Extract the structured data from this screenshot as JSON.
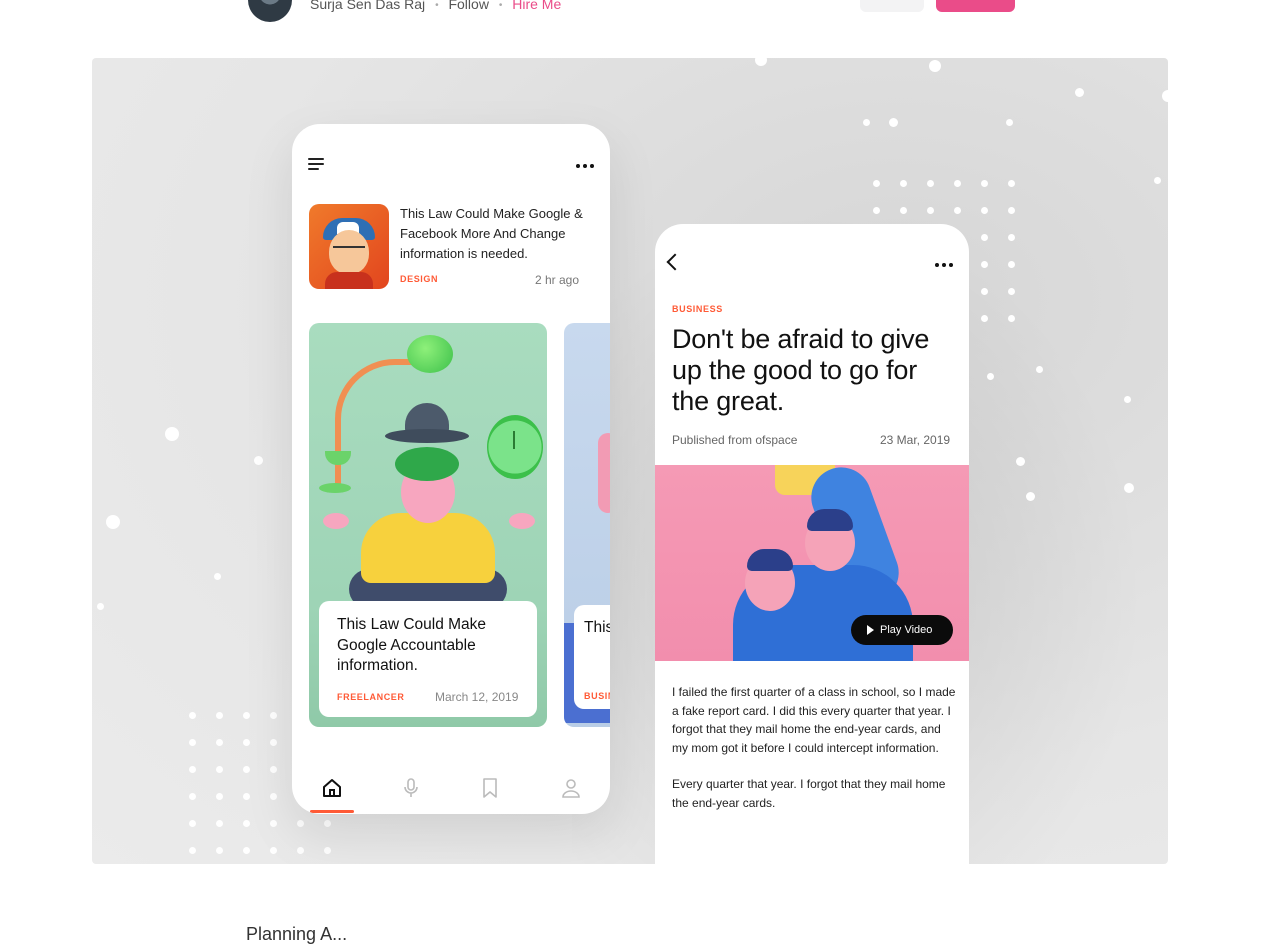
{
  "author": {
    "name": "Surja Sen Das Raj",
    "follow_label": "Follow",
    "hire_label": "Hire Me",
    "separator": "•"
  },
  "phone_left": {
    "featured": {
      "title": "This Law Could Make Google & Facebook More And Change information is needed.",
      "category": "DESIGN",
      "time": "2 hr ago"
    },
    "cards": [
      {
        "title": "This Law Could Make Google Accountable information.",
        "category": "FREELANCER",
        "date": "March 12, 2019"
      },
      {
        "title": "This Law Could Make Google Accountable information.",
        "category": "BUSINESS"
      }
    ],
    "tabs": [
      "home-icon",
      "microphone-icon",
      "bookmark-icon",
      "profile-icon"
    ],
    "active_tab": "home-icon"
  },
  "phone_right": {
    "category": "BUSINESS",
    "title": "Don't be afraid to give up the good to go for the great.",
    "source": "Published from ofspace",
    "date": "23 Mar, 2019",
    "play_label": "Play Video",
    "paragraphs": [
      "I failed the first quarter of a class in school, so I made a fake report card. I did this every quarter that year. I forgot that they mail home the end-year cards, and my mom got it before I could intercept information.",
      "Every quarter that year. I forgot that they mail home the end-year cards."
    ]
  },
  "footer": {
    "partial_text": "Planning A..."
  },
  "colors": {
    "accent": "#ff5a36",
    "hire": "#ea4c89",
    "card_green": "#a9dcbf",
    "image_pink": "#f59ab5"
  }
}
